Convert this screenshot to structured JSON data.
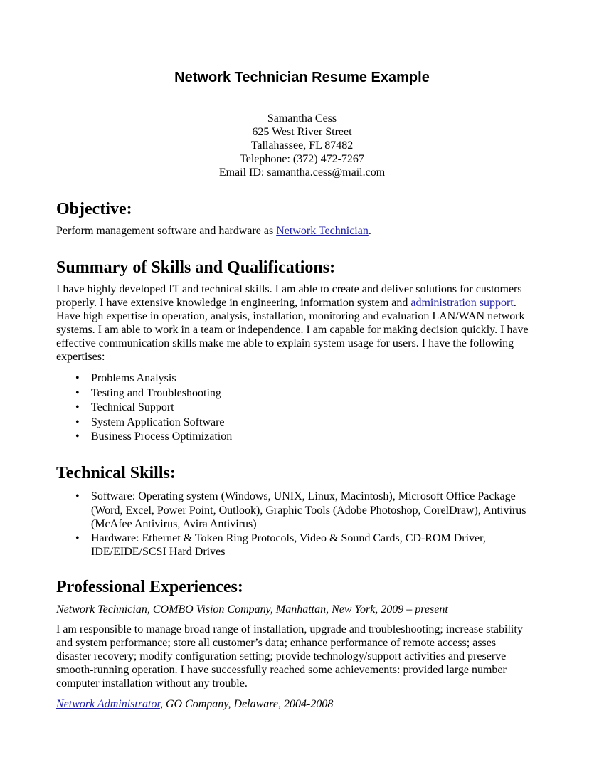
{
  "document": {
    "title": "Network Technician Resume Example",
    "contact": {
      "name": "Samantha Cess",
      "street": "625 West River Street",
      "city": "Tallahassee, FL 87482",
      "telephone": "Telephone: (372) 472-7267",
      "email": "Email ID: samantha.cess@mail.com"
    },
    "objective": {
      "heading": "Objective:",
      "text_before": "Perform management software and hardware as ",
      "link": "Network Technician",
      "text_after": "."
    },
    "summary": {
      "heading": "Summary of Skills and Qualifications:",
      "line1": "I have highly developed IT and technical skills. I am able to create and deliver solutions for customers",
      "line2_before": "properly. I have extensive knowledge in engineering, information system and ",
      "line2_link": "administration support",
      "line2_after": ".",
      "line3": "Have high expertise in operation, analysis, installation, monitoring and evaluation LAN/WAN network",
      "line4": "systems. I am able to work in a team or independence. I am capable for making decision quickly. I have",
      "line5": "effective communication skills make me able to explain system usage for users. I have the following",
      "line6": "expertises:",
      "bullet_glyph": "•",
      "items": [
        "Problems Analysis",
        "Testing and Troubleshooting",
        "Technical Support",
        "System Application Software",
        "Business Process Optimization"
      ]
    },
    "technical": {
      "heading": "Technical Skills:",
      "items": [
        {
          "lines": [
            "Software: Operating system (Windows, UNIX, Linux, Macintosh), Microsoft Office Package",
            "(Word, Excel, Power Point, Outlook), Graphic Tools (Adobe Photoshop, CorelDraw), Antivirus",
            "(McAfee Antivirus, Avira Antivirus)"
          ]
        },
        {
          "lines": [
            "Hardware: Ethernet & Token Ring Protocols, Video & Sound Cards, CD-ROM Driver,",
            "IDE/EIDE/SCSI Hard Drives"
          ]
        }
      ]
    },
    "experience": {
      "heading": "Professional Experiences:",
      "job1_title": "Network Technician, COMBO Vision Company, Manhattan, New York, 2009 – present",
      "job1_lines": [
        "I am responsible to manage broad range of installation, upgrade and troubleshooting; increase stability",
        "and system performance; store all customer’s data; enhance performance of remote access; asses",
        "disaster recovery; modify configuration setting; provide technology/support activities and preserve",
        "smooth-running operation. I have successfully reached some achievements: provided large number",
        "computer installation without any trouble."
      ],
      "job2_link": "Network Administrator",
      "job2_rest": ", GO Company, Delaware, 2004-2008"
    }
  }
}
